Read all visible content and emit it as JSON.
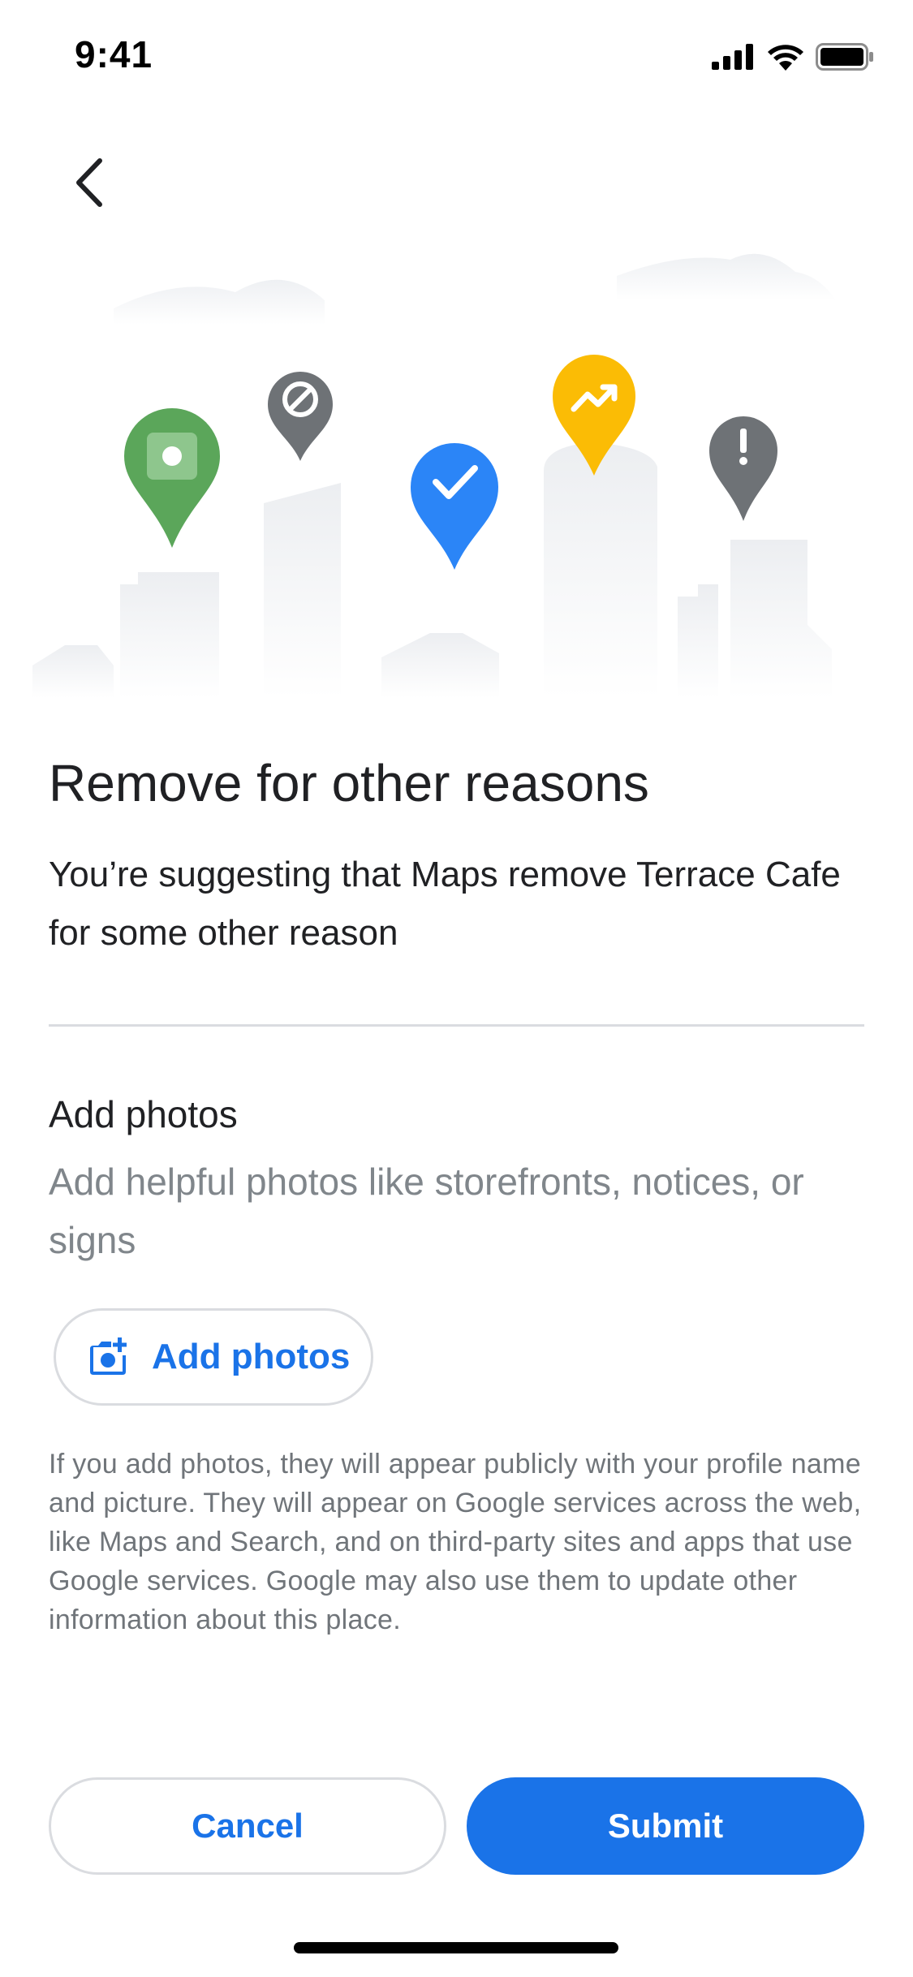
{
  "status_bar": {
    "time": "9:41",
    "icons": [
      "signal-icon",
      "wifi-icon",
      "battery-icon"
    ]
  },
  "header": {
    "back_icon": "chevron-left-icon"
  },
  "illustration": {
    "pins": [
      {
        "name": "green-square-pin",
        "color": "#5ba65a"
      },
      {
        "name": "gray-blocked-pin",
        "color": "#6e7276"
      },
      {
        "name": "blue-check-pin",
        "color": "#2b85f7"
      },
      {
        "name": "yellow-trending-pin",
        "color": "#fbbc05"
      },
      {
        "name": "gray-exclamation-pin",
        "color": "#6e7276"
      }
    ]
  },
  "main": {
    "title": "Remove for other reasons",
    "description": "You’re suggesting that Maps remove Terrace Cafe for some other reason"
  },
  "photos_section": {
    "title": "Add photos",
    "description": "Add helpful photos like storefronts, notices, or signs",
    "button_label": "Add photos",
    "button_icon": "add-photo-camera-icon",
    "disclaimer": "If you add photos, they will appear publicly with your profile name and picture. They will appear on Google services across the web, like Maps and Search, and on third-party sites and apps that use Google services. Google may also use them to update other information about this place."
  },
  "footer": {
    "cancel_label": "Cancel",
    "submit_label": "Submit"
  },
  "colors": {
    "accent": "#1a73e8",
    "divider": "#dadce0",
    "secondary_text": "#80868b"
  }
}
